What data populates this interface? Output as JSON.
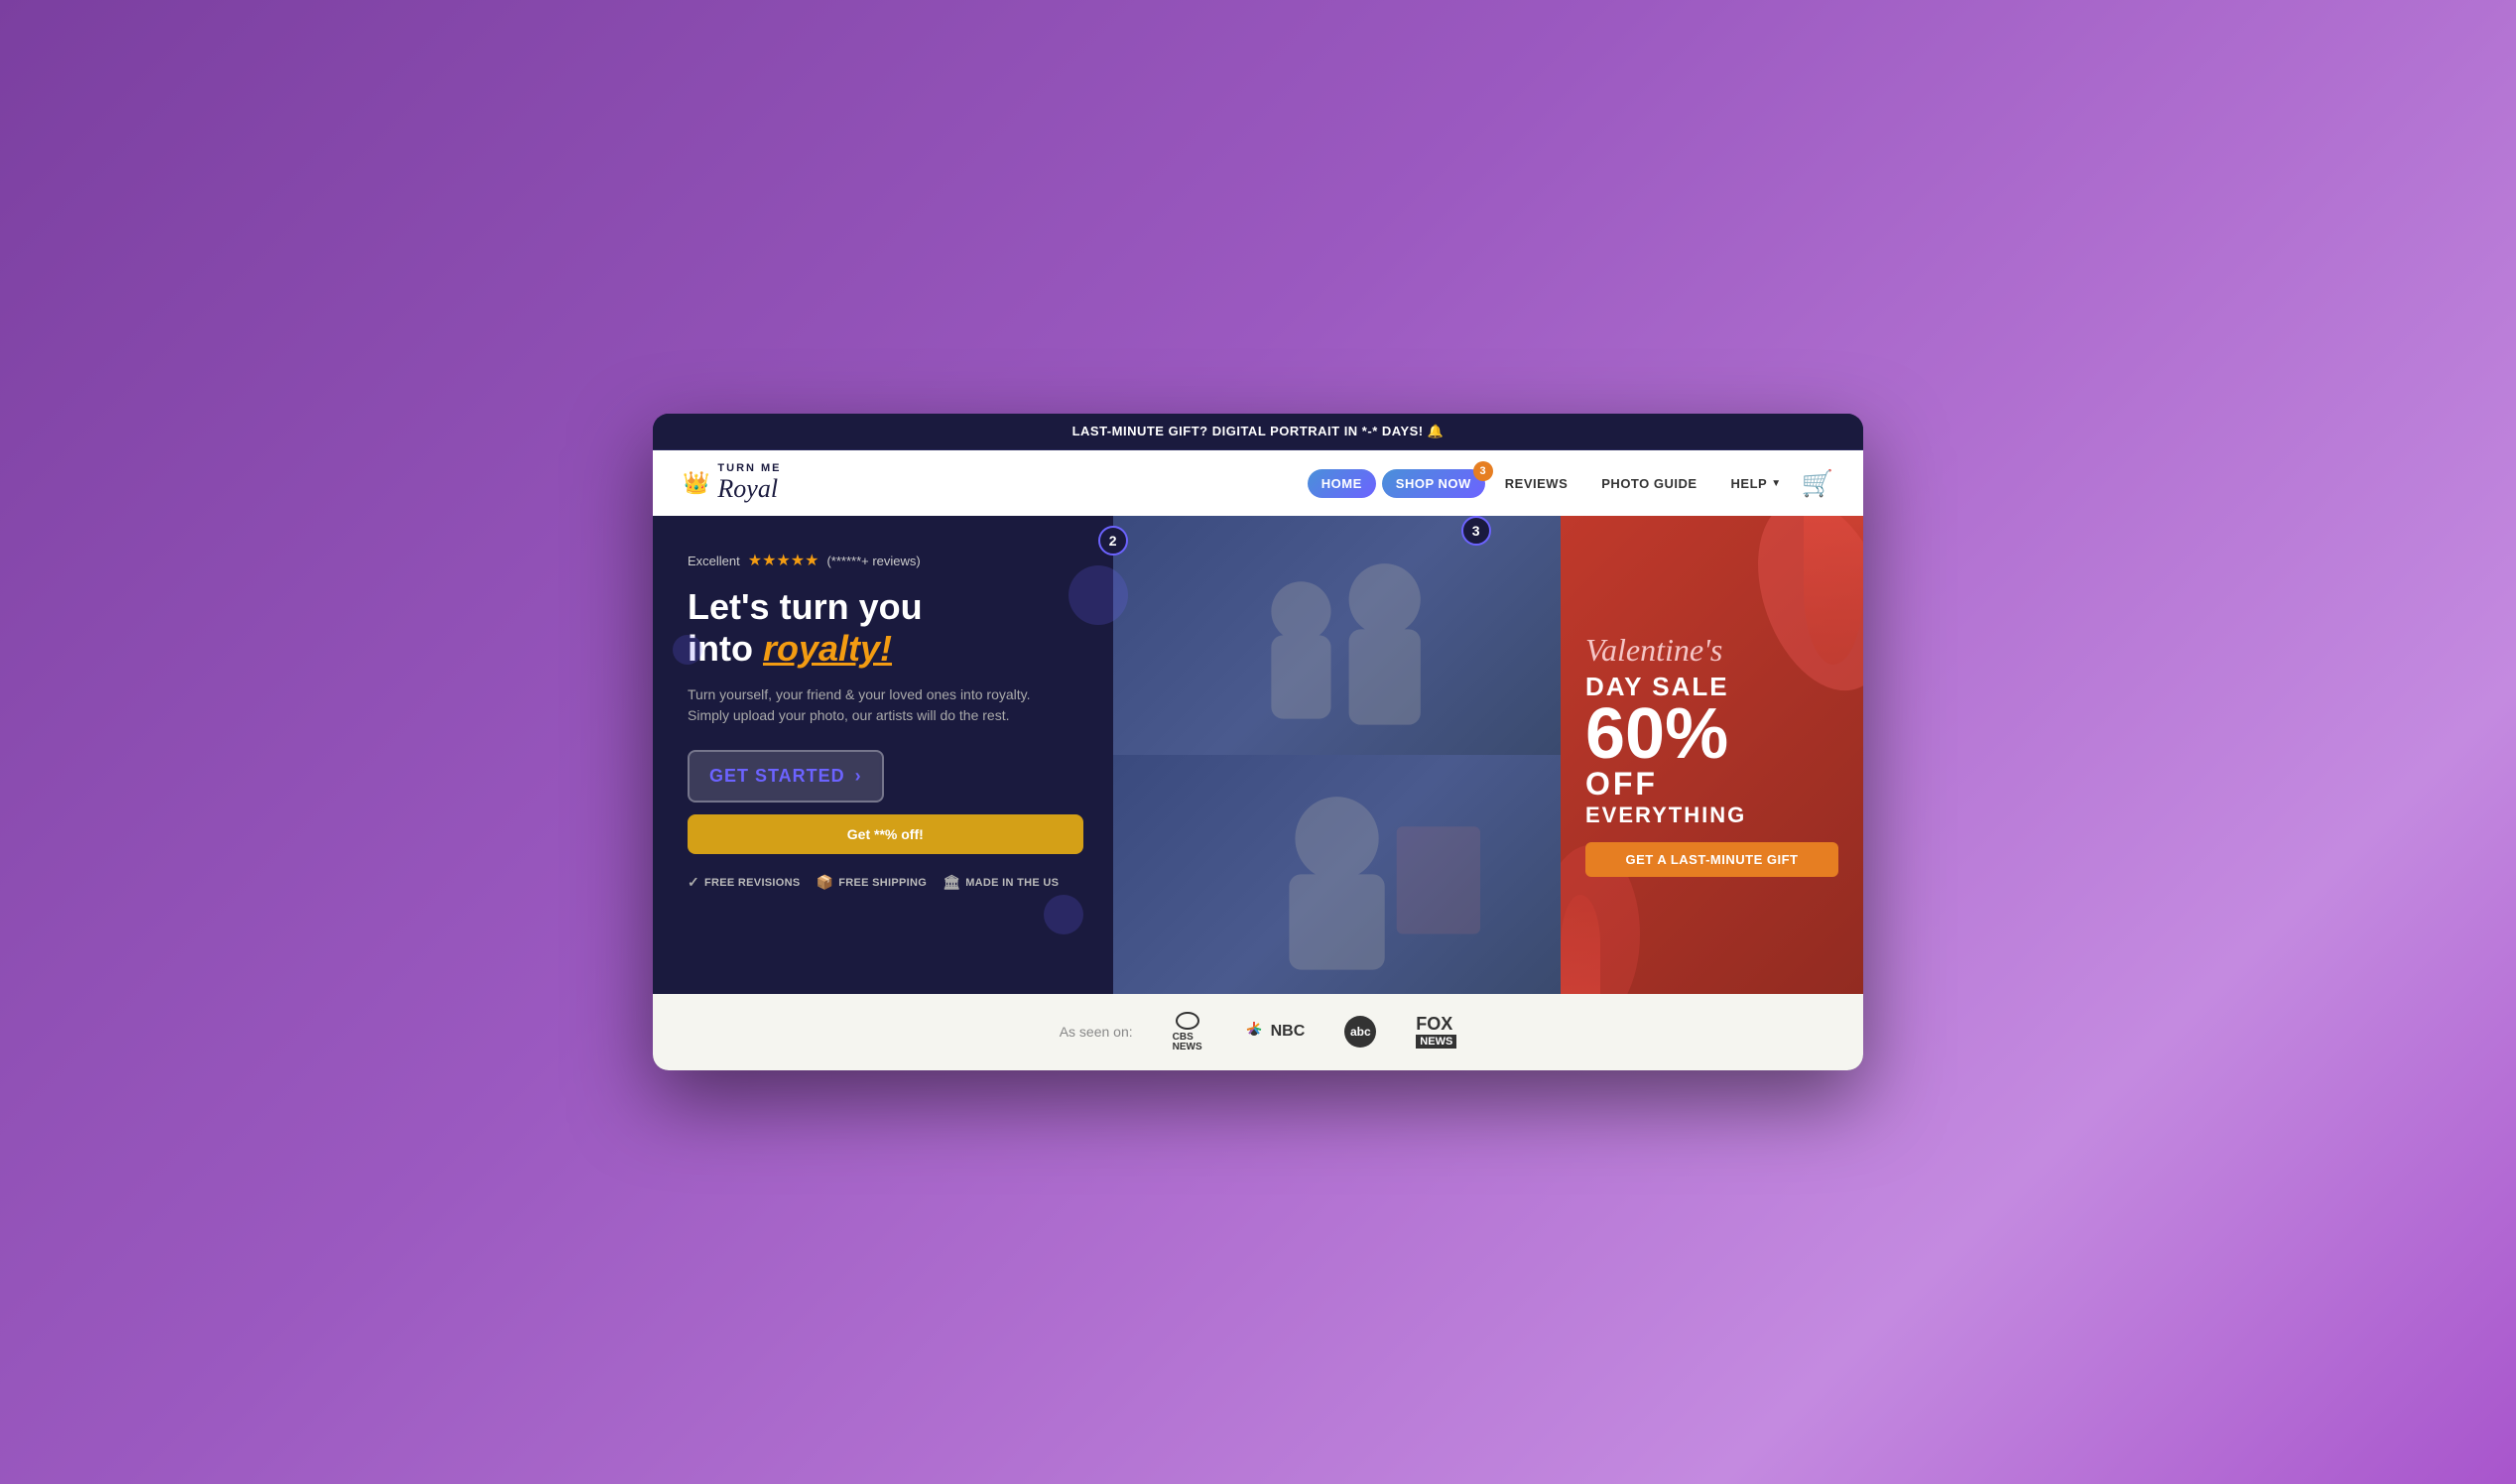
{
  "announcement_bar": {
    "text": "LAST-MINUTE GIFT? DIGITAL PORTRAIT IN *-* DAYS! 🔔"
  },
  "navbar": {
    "logo": {
      "top_text": "TURN ME",
      "bottom_text": "Royal"
    },
    "menu_items": [
      {
        "label": "HOME",
        "type": "home"
      },
      {
        "label": "SHOP NOW",
        "type": "shop"
      },
      {
        "label": "REVIEWS",
        "type": "link"
      },
      {
        "label": "PHOTO GUIDE",
        "type": "link"
      },
      {
        "label": "HELP",
        "type": "dropdown"
      }
    ],
    "cart_badge": "3"
  },
  "hero": {
    "rating": {
      "label": "Excellent",
      "stars": "★★★★★",
      "count": "(******+ reviews)"
    },
    "headline_part1": "Let's turn you",
    "headline_part2": "into ",
    "headline_highlight": "royalty!",
    "subtext": "Turn yourself, your friend & your loved ones into royalty.\nSimply upload your photo, our artists will do the rest.",
    "get_started_label": "GET STARTED",
    "discount_label": "Get **% off!",
    "features": [
      {
        "icon": "✓",
        "label": "FREE REVISIONS"
      },
      {
        "icon": "📦",
        "label": "FREE SHIPPING"
      },
      {
        "icon": "🏛",
        "label": "MADE IN THE US"
      }
    ]
  },
  "valentine": {
    "title": "Valentine's",
    "day_sale": "DAY SALE",
    "percent": "60%",
    "off": "OFF",
    "everything": "EVERYTHING",
    "cta": "GET A LAST-MINUTE GIFT"
  },
  "as_seen_on": {
    "label": "As seen on:",
    "logos": [
      "CBS NEWS",
      "NBC",
      "abc",
      "FOX NEWS"
    ]
  },
  "steps": {
    "step2_label": "2",
    "step3_label": "3"
  }
}
